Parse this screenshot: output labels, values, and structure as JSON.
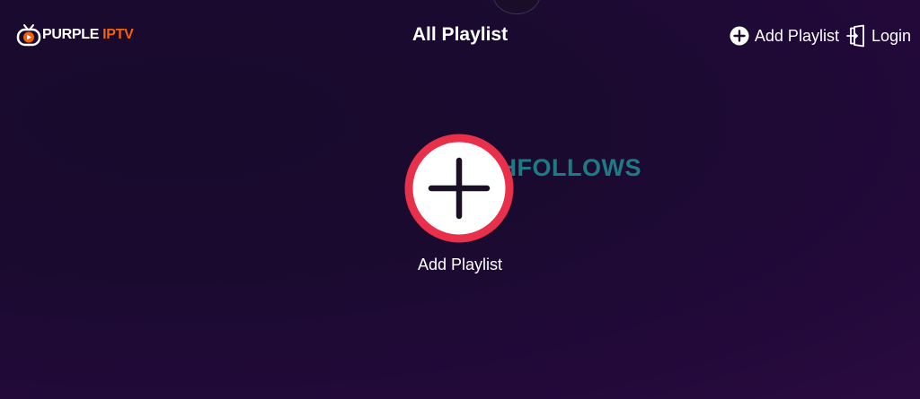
{
  "app": {
    "logo_word_a": "PURPLE",
    "logo_word_b": "IPTV"
  },
  "header": {
    "title": "All Playlist",
    "add_playlist_label": "Add Playlist",
    "login_label": "Login"
  },
  "main": {
    "add_playlist_caption": "Add Playlist",
    "watermark": "TECHFOLLOWS"
  },
  "icons": {
    "logo": "tv-play-icon",
    "add": "plus-circle-icon",
    "login": "door-enter-icon",
    "big_add": "plus-icon"
  },
  "colors": {
    "background": "#1b0a30",
    "brand_orange": "#f0620e",
    "accent_red": "#e8304a",
    "watermark": "#1f8f93"
  }
}
